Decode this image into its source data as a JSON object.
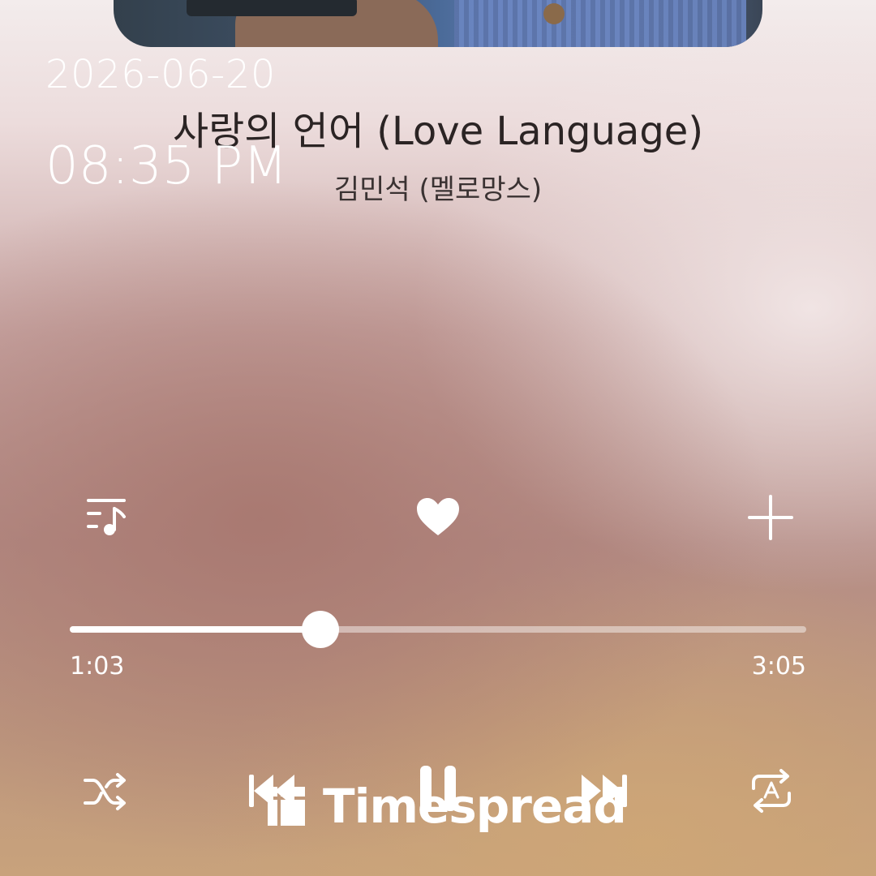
{
  "overlay": {
    "date": "2026-06-20",
    "time": "08:35 PM"
  },
  "track": {
    "title": "사랑의 언어 (Love Language)",
    "artist": "김민석 (멜로망스)",
    "elapsed": "1:03",
    "duration": "3:05",
    "progress_fraction": 0.34
  },
  "icons": {
    "playlist": "playlist-music-icon",
    "like": "heart-icon",
    "add": "plus-icon",
    "shuffle": "shuffle-icon",
    "previous": "skip-previous-icon",
    "play_pause": "pause-icon",
    "next": "skip-next-icon",
    "repeat": "repeat-auto-icon"
  },
  "watermark": {
    "text": "Timespread"
  },
  "colors": {
    "icon": "#ffffff",
    "title": "#2b2424",
    "artist": "#3a3232"
  }
}
